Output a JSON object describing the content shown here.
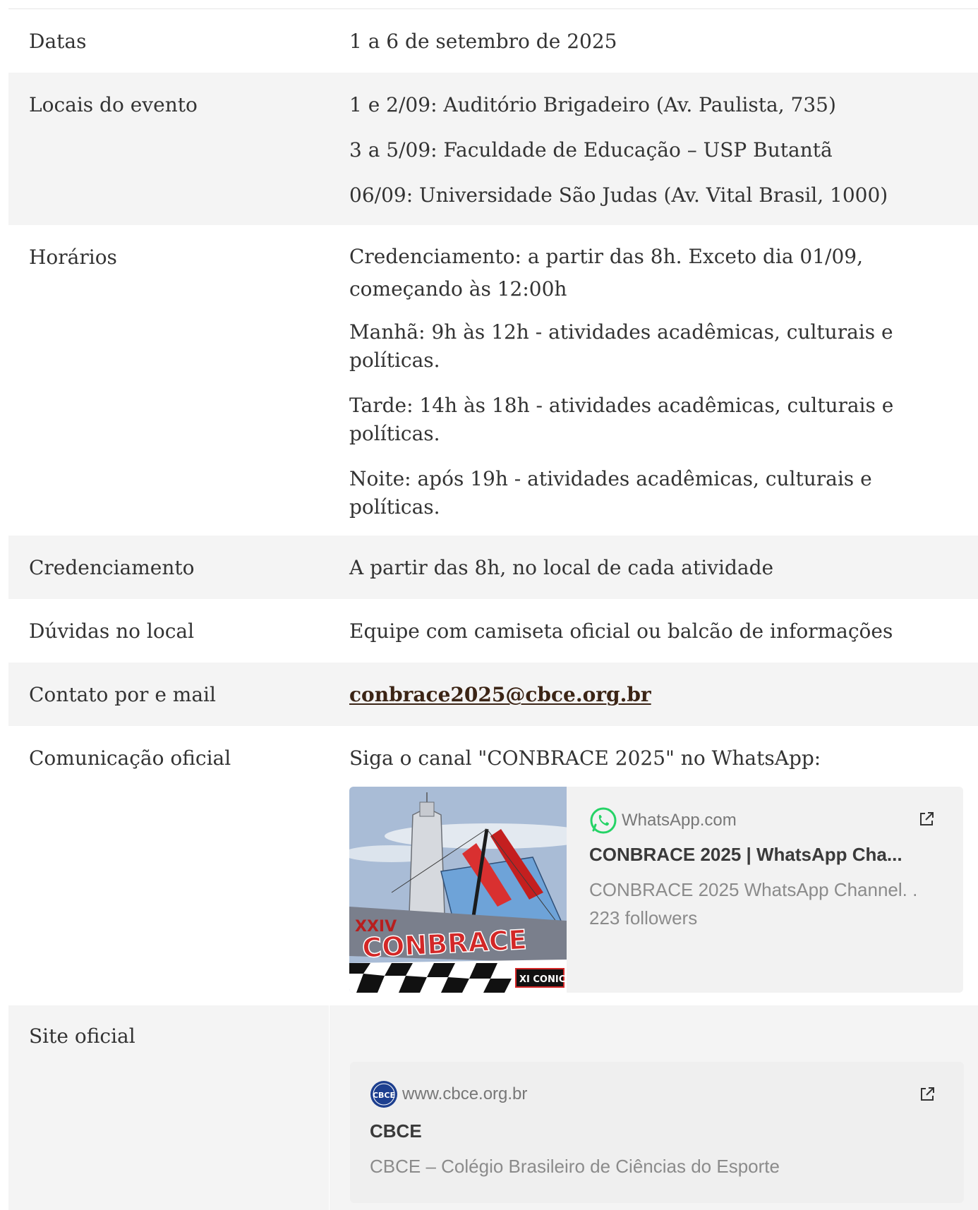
{
  "rows": [
    {
      "label": "Datas",
      "lines": [
        "1 a 6 de setembro de 2025"
      ]
    },
    {
      "label": "Locais do evento",
      "lines": [
        "1 e 2/09: Auditório Brigadeiro (Av. Paulista, 735)",
        "3 a 5/09: Faculdade de Educação – USP Butantã",
        "06/09: Universidade São Judas (Av. Vital Brasil, 1000)"
      ]
    },
    {
      "label": "Horários",
      "lines": [
        "Credenciamento: a partir das 8h. Exceto dia 01/09, começando às 12:00h",
        "Manhã: 9h às 12h - atividades acadêmicas, culturais e políticas.",
        "Tarde: 14h às 18h - atividades acadêmicas, culturais e políticas.",
        "Noite: após 19h - atividades acadêmicas, culturais e políticas."
      ]
    },
    {
      "label": "Credenciamento",
      "lines": [
        "A partir das 8h, no local de cada atividade"
      ]
    },
    {
      "label": "Dúvidas no local",
      "lines": [
        "Equipe com camiseta oficial ou balcão de informações"
      ]
    },
    {
      "label": "Contato por e mail",
      "email": "conbrace2025@cbce.org.br"
    },
    {
      "label": "Comunicação oficial",
      "lines": [
        "Siga o canal \"CONBRACE 2025\" no WhatsApp:"
      ]
    },
    {
      "label": "Site oficial"
    }
  ],
  "whatsapp_card": {
    "domain": "WhatsApp.com",
    "title": "CONBRACE 2025 | WhatsApp Cha...",
    "desc_line1": "CONBRACE 2025 WhatsApp Channel. .",
    "desc_line2": "223 followers",
    "thumb_text_1": "XXIV",
    "thumb_text_2": "CONBRACE",
    "thumb_text_3": "XI CONICE"
  },
  "site_card": {
    "domain": "www.cbce.org.br",
    "title": "CBCE",
    "desc": "CBCE – Colégio Brasileiro de Ciências do Esporte",
    "logo_text": "CBCE"
  },
  "colors": {
    "row_alt": "#f4f4f4",
    "link": "#3b2415",
    "whatsapp_green": "#25d366"
  }
}
